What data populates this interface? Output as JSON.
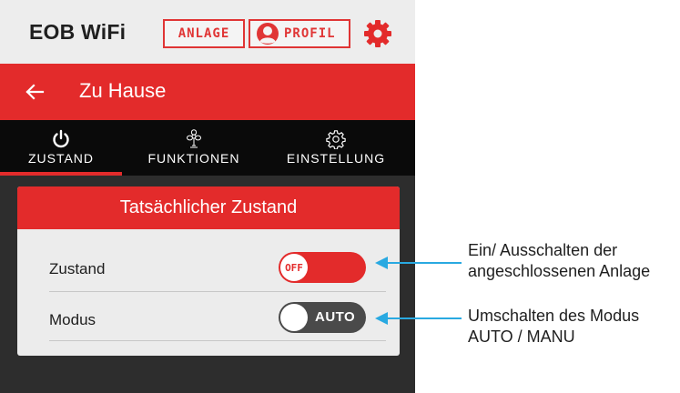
{
  "topbar": {
    "app_title": "EOB WiFi",
    "anlage_label": "ANLAGE",
    "profil_label": "PROFIL",
    "icons": [
      "avatar-icon",
      "gear-icon"
    ],
    "accent_color": "#e32b2b"
  },
  "header": {
    "title": "Zu Hause",
    "back_icon": "arrow-left-icon"
  },
  "tabs": [
    {
      "label": "ZUSTAND",
      "icon": "power-icon",
      "active": true
    },
    {
      "label": "FUNKTIONEN",
      "icon": "fan-icon",
      "active": false
    },
    {
      "label": "EINSTELLUNG",
      "icon": "gear-icon",
      "active": false
    }
  ],
  "card": {
    "title": "Tatsächlicher Zustand",
    "rows": [
      {
        "label": "Zustand",
        "toggle_text": "OFF",
        "state": "off"
      },
      {
        "label": "Modus",
        "toggle_text": "AUTO",
        "state": "auto"
      }
    ]
  },
  "annotations": [
    {
      "line1": "Ein/ Ausschalten der",
      "line2": "angeschlossenen Anlage"
    },
    {
      "line1": "Umschalten des Modus",
      "line2": "AUTO / MANU"
    }
  ],
  "colors": {
    "arrow": "#29a9e1",
    "header_red": "#e32b2b",
    "dark_bg": "#2d2d2d"
  }
}
